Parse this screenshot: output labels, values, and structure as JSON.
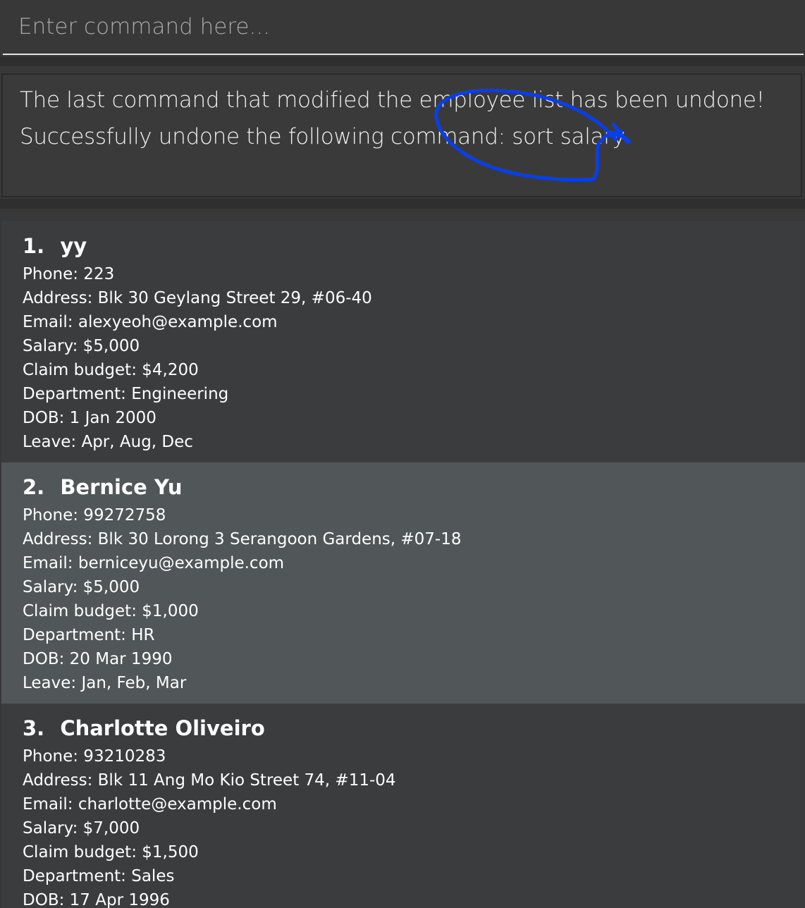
{
  "command_box": {
    "placeholder": "Enter command here...",
    "value": ""
  },
  "result_display": {
    "lines": [
      "The last command that modified the employee list has been undone!",
      "Successfully undone the following command: sort salary"
    ],
    "annotation_color": "#0a3fe6"
  },
  "employees": [
    {
      "index": "1.",
      "name": "yy",
      "phone": "Phone: 223",
      "address": "Address: Blk 30 Geylang Street 29, #06-40",
      "email": "Email: alexyeoh@example.com",
      "salary": "Salary: $5,000",
      "claim_budget": "Claim budget: $4,200",
      "department": "Department: Engineering",
      "dob": "DOB: 1 Jan 2000",
      "leave": "Leave: Apr, Aug, Dec"
    },
    {
      "index": "2.",
      "name": "Bernice Yu",
      "phone": "Phone: 99272758",
      "address": "Address: Blk 30 Lorong 3 Serangoon Gardens, #07-18",
      "email": "Email: berniceyu@example.com",
      "salary": "Salary: $5,000",
      "claim_budget": "Claim budget: $1,000",
      "department": "Department: HR",
      "dob": "DOB: 20 Mar 1990",
      "leave": "Leave: Jan, Feb, Mar"
    },
    {
      "index": "3.",
      "name": "Charlotte Oliveiro",
      "phone": "Phone: 93210283",
      "address": "Address: Blk 11 Ang Mo Kio Street 74, #11-04",
      "email": "Email: charlotte@example.com",
      "salary": "Salary: $7,000",
      "claim_budget": "Claim budget: $1,500",
      "department": "Department: Sales",
      "dob": "DOB: 17 Apr 1996",
      "leave": ""
    }
  ],
  "colors": {
    "background": "#383838",
    "card_odd": "#3b3c3e",
    "card_selected": "#515658",
    "text": "#ffffff"
  }
}
